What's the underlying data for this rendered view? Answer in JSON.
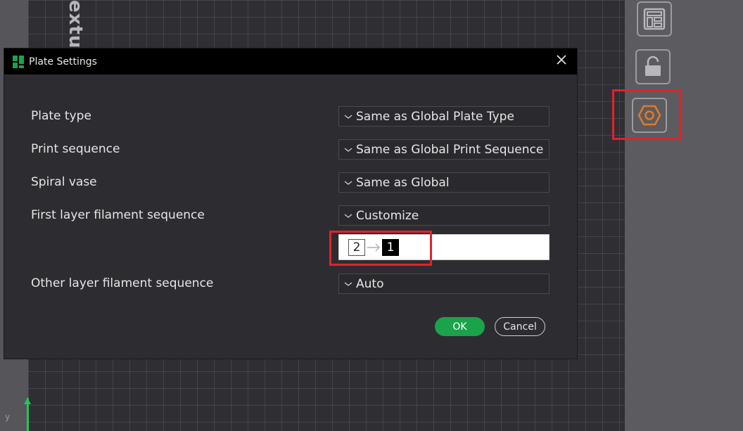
{
  "viewport": {
    "texture_label": "extur",
    "axis_label": "y"
  },
  "dialog": {
    "title": "Plate Settings",
    "close_glyph": "✕",
    "rows": [
      {
        "label": "Plate type",
        "value": "Same as Global Plate Type"
      },
      {
        "label": "Print sequence",
        "value": "Same as Global Print Sequence"
      },
      {
        "label": "Spiral vase",
        "value": "Same as Global"
      },
      {
        "label": "First layer filament sequence",
        "value": "Customize"
      },
      {
        "label": "Other layer filament sequence",
        "value": "Auto"
      }
    ],
    "sequence": [
      "2",
      "1"
    ],
    "ok_label": "OK",
    "cancel_label": "Cancel"
  },
  "toolbar": {
    "icons": [
      "layout-icon",
      "unlock-icon",
      "plate-settings-icon"
    ]
  },
  "colors": {
    "accent_green": "#1aa34a",
    "highlight_red": "#e0232c",
    "settings_orange": "#e07b2a"
  }
}
